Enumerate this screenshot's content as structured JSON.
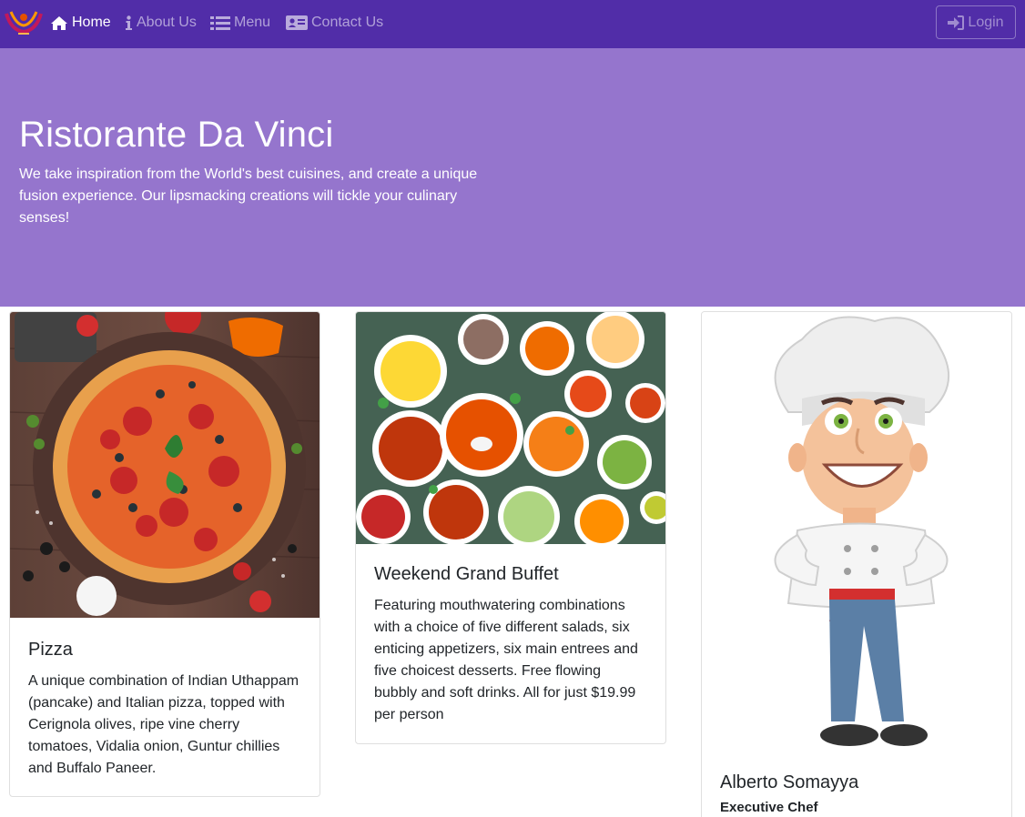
{
  "navbar": {
    "logo_icon": "restaurant-logo",
    "items": [
      {
        "label": "Home",
        "icon": "home-icon",
        "active": true
      },
      {
        "label": "About Us",
        "icon": "info-icon",
        "active": false
      },
      {
        "label": "Menu",
        "icon": "list-icon",
        "active": false
      },
      {
        "label": "Contact Us",
        "icon": "address-card-icon",
        "active": false
      }
    ],
    "login_label": "Login",
    "login_icon": "sign-in-icon"
  },
  "hero": {
    "title": "Ristorante Da Vinci",
    "text": "We take inspiration from the World's best cuisines, and create a unique fusion experience. Our lipsmacking creations will tickle your culinary senses!"
  },
  "cards": [
    {
      "title": "Pizza",
      "text": "A unique combination of Indian Uthappam (pancake) and Italian pizza, topped with Cerignola olives, ripe vine cherry tomatoes, Vidalia onion, Guntur chillies and Buffalo Paneer."
    },
    {
      "title": "Weekend Grand Buffet",
      "text": "Featuring mouthwatering combinations with a choice of five different salads, six enticing appetizers, six main entrees and five choicest desserts. Free flowing bubbly and soft drinks. All for just $19.99 per person"
    },
    {
      "title": "Alberto Somayya",
      "subtitle": "Executive Chef"
    }
  ],
  "colors": {
    "navbar": "#512da8",
    "hero": "#9575cd"
  }
}
